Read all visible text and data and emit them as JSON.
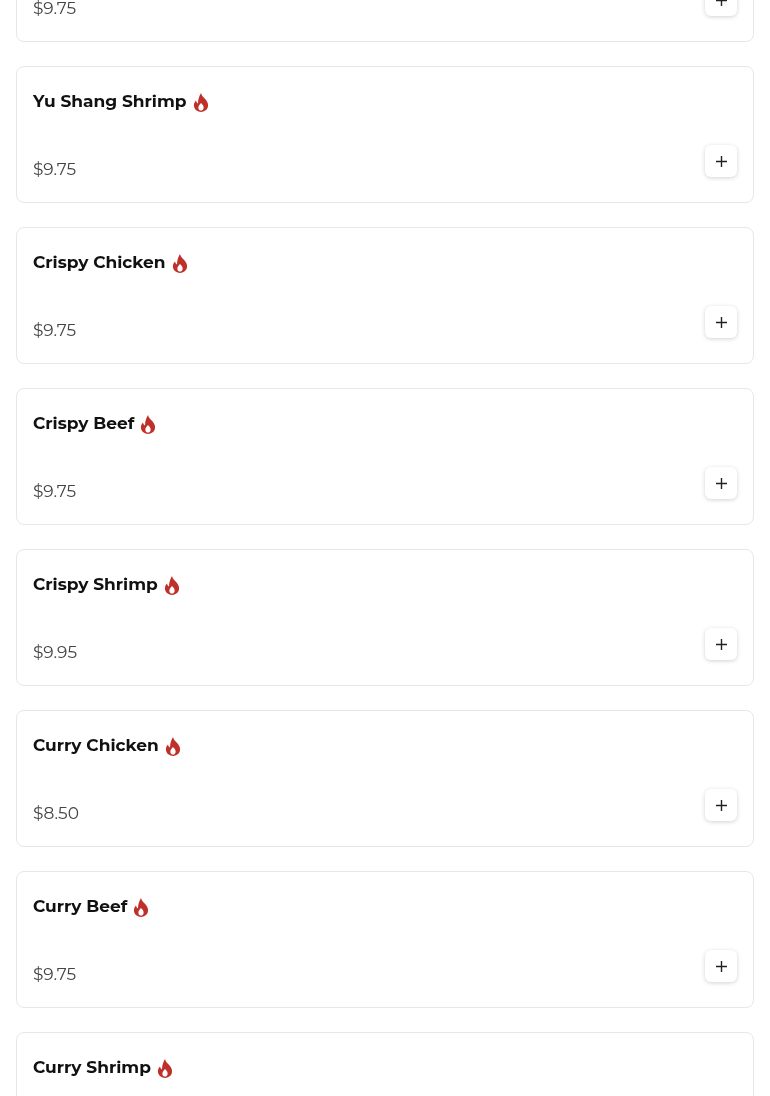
{
  "items": [
    {
      "price": "$9.75"
    },
    {
      "name": "Yu Shang Shrimp",
      "spicy": true,
      "price": "$9.75"
    },
    {
      "name": "Crispy Chicken",
      "spicy": true,
      "price": "$9.75"
    },
    {
      "name": "Crispy Beef",
      "spicy": true,
      "price": "$9.75"
    },
    {
      "name": "Crispy Shrimp",
      "spicy": true,
      "price": "$9.95"
    },
    {
      "name": "Curry Chicken",
      "spicy": true,
      "price": "$8.50"
    },
    {
      "name": "Curry Beef",
      "spicy": true,
      "price": "$9.75"
    },
    {
      "name": "Curry Shrimp",
      "spicy": true
    }
  ]
}
